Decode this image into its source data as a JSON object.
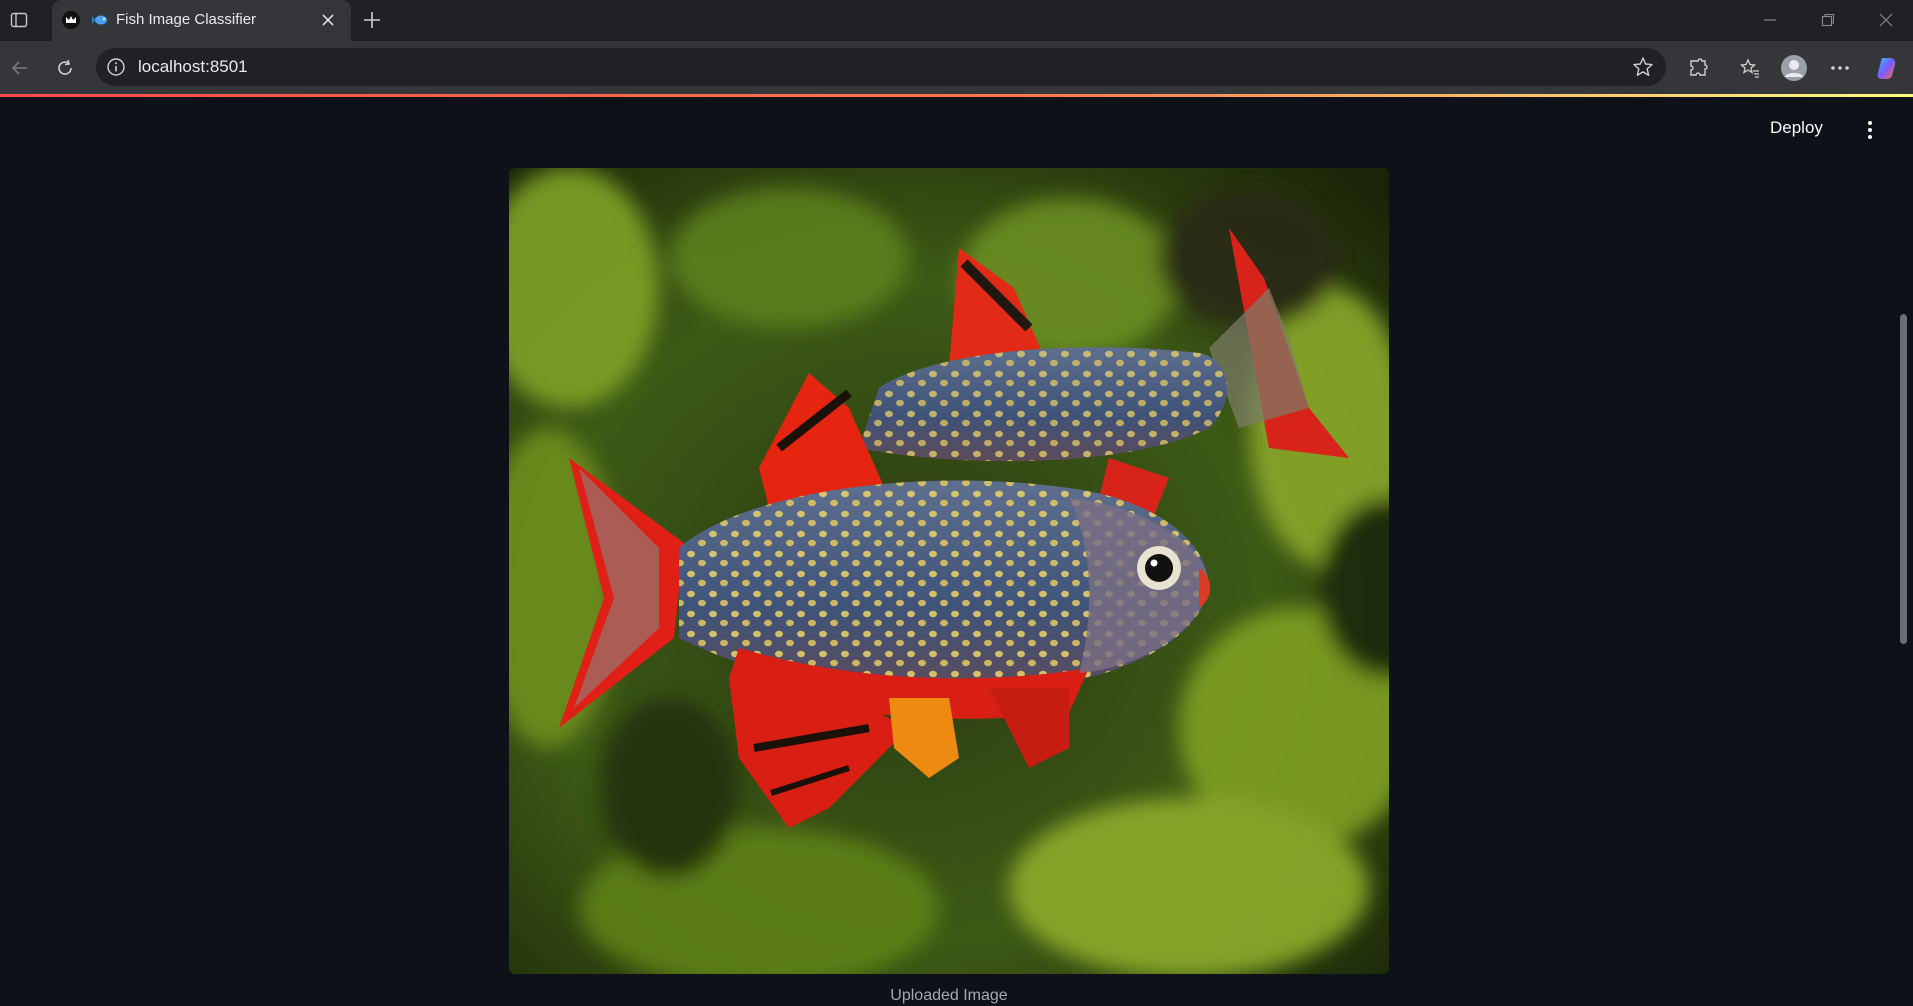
{
  "browser": {
    "tab_title": "Fish Image Classifier",
    "url": "localhost:8501"
  },
  "app": {
    "deploy_label": "Deploy",
    "image_caption": "Uploaded Image"
  },
  "colors": {
    "background": "#0e1117",
    "accent_gradient": [
      "#ff4b4b",
      "#fffd80"
    ],
    "fish_body": "#4a5f86",
    "fish_fins": "#e82418",
    "fish_spots": "#ecd36a",
    "plant_green": "#6f8f20"
  },
  "icons": [
    "sidebar-toggle-icon",
    "streamlit-crown-icon",
    "fish-app-icon",
    "close-icon",
    "plus-icon",
    "minimize-icon",
    "restore-icon",
    "back-arrow-icon",
    "refresh-icon",
    "info-icon",
    "star-icon",
    "extensions-icon",
    "favorites-icon",
    "profile-icon",
    "more-horizontal-icon",
    "copilot-icon",
    "kebab-menu-icon"
  ]
}
